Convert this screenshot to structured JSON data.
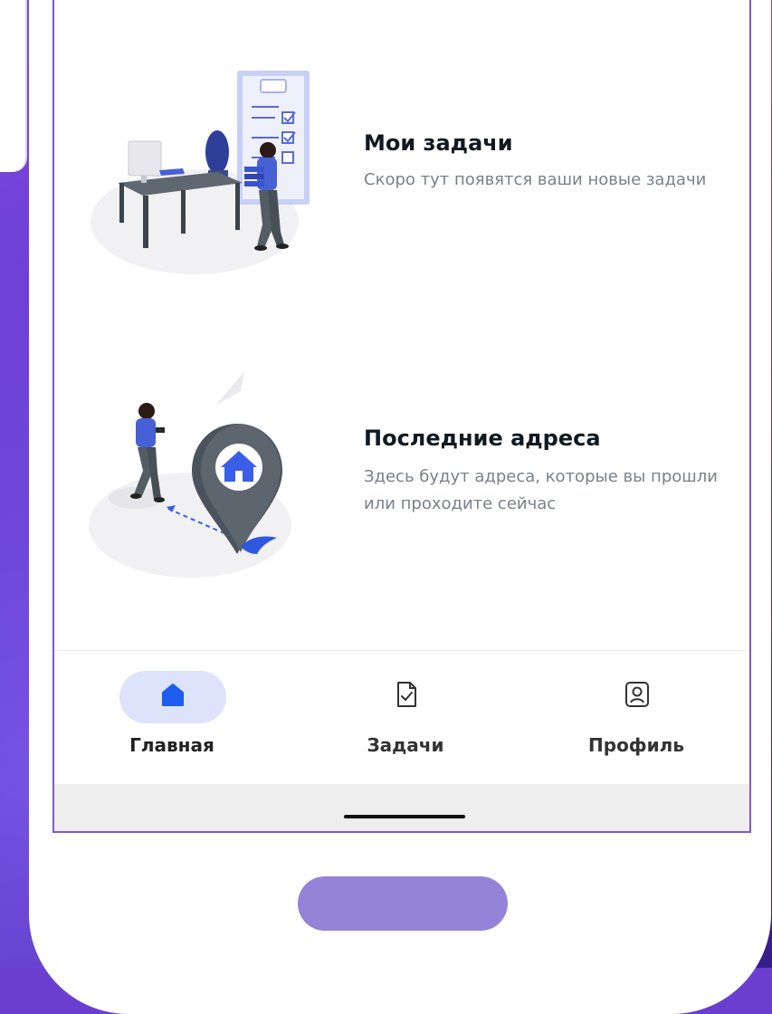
{
  "cards": [
    {
      "title": "Мои задачи",
      "description": "Скоро тут появятся ваши новые задачи"
    },
    {
      "title": "Последние адреса",
      "description": "Здесь будут адреса, которые вы прошли или проходите сейчас"
    }
  ],
  "nav": {
    "items": [
      {
        "label": "Главная",
        "icon": "home-icon",
        "active": true
      },
      {
        "label": "Задачи",
        "icon": "task-document-icon",
        "active": false
      },
      {
        "label": "Профиль",
        "icon": "profile-icon",
        "active": false
      }
    ]
  },
  "colors": {
    "background": "#6a3fd0",
    "accent": "#1f5cf0",
    "active_pill": "#dde3fb",
    "title_text": "#111a22",
    "description_text": "#7b8088",
    "phone_button": "#9583d8"
  }
}
